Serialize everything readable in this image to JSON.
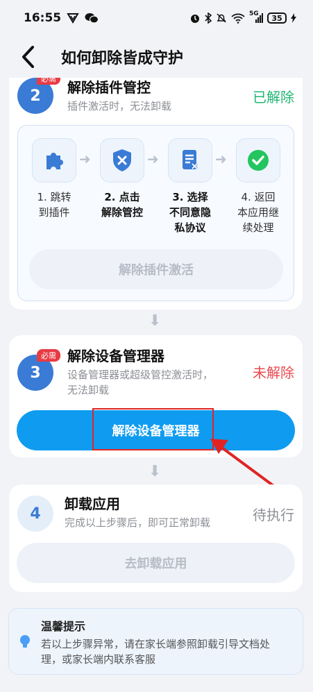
{
  "status_bar": {
    "time": "16:55",
    "network_label": "5G",
    "battery": "35"
  },
  "header": {
    "title": "如何卸除皆成守护"
  },
  "step2": {
    "number": "2",
    "badge": "必需",
    "title": "解除插件管控",
    "desc": "插件激活时，无法卸载",
    "status": "已解除",
    "status_color": "#22b573",
    "flow": [
      {
        "line1": "1. 跳转",
        "line2": "到插件",
        "line3": ""
      },
      {
        "line1": "2. 点击",
        "line2": "解除管控",
        "line3": ""
      },
      {
        "line1": "3. 选择",
        "line2": "不同意隐",
        "line3": "私协议"
      },
      {
        "line1": "4. 返回",
        "line2": "本应用继",
        "line3": "续处理"
      }
    ],
    "button": "解除插件激活"
  },
  "step3": {
    "number": "3",
    "badge": "必需",
    "title": "解除设备管理器",
    "desc_line1": "设备管理器或超级管控激活时，",
    "desc_line2": "无法卸载",
    "status": "未解除",
    "status_color": "#e84a50",
    "button": "解除设备管理器"
  },
  "step4": {
    "number": "4",
    "title": "卸载应用",
    "desc": "完成以上步骤后，即可正常卸载",
    "status": "待执行",
    "button": "去卸载应用"
  },
  "tips": {
    "title": "温馨提示",
    "line1": "若以上步骤异常，请在家长端参照卸载引导文档处",
    "line2": "理，或家长端内联系客服"
  }
}
